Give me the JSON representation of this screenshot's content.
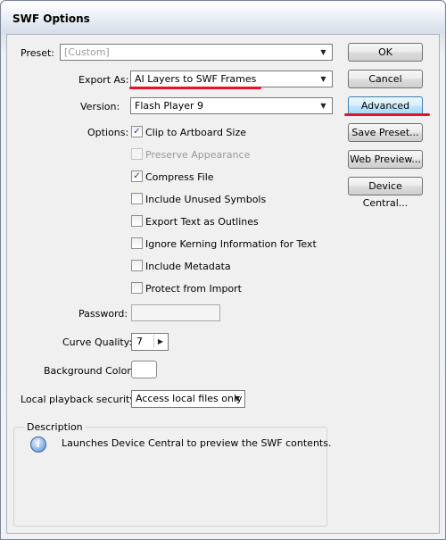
{
  "window": {
    "title": "SWF Options"
  },
  "preset": {
    "label": "Preset:",
    "value": "[Custom]"
  },
  "export_as": {
    "label": "Export As:",
    "value": "AI Layers to SWF Frames"
  },
  "version": {
    "label": "Version:",
    "value": "Flash Player 9"
  },
  "options": {
    "label": "Options:",
    "items": [
      {
        "label": "Clip to Artboard Size",
        "checked": true,
        "enabled": true
      },
      {
        "label": "Preserve Appearance",
        "checked": false,
        "enabled": false
      },
      {
        "label": "Compress File",
        "checked": true,
        "enabled": true
      },
      {
        "label": "Include Unused Symbols",
        "checked": false,
        "enabled": true
      },
      {
        "label": "Export Text as Outlines",
        "checked": false,
        "enabled": true
      },
      {
        "label": "Ignore Kerning Information for Text",
        "checked": false,
        "enabled": true
      },
      {
        "label": "Include Metadata",
        "checked": false,
        "enabled": true
      },
      {
        "label": "Protect from Import",
        "checked": false,
        "enabled": true
      }
    ]
  },
  "password": {
    "label": "Password:",
    "value": ""
  },
  "curve_quality": {
    "label": "Curve Quality:",
    "value": "7"
  },
  "background_color": {
    "label": "Background Color:",
    "color": "#ffffff"
  },
  "local_playback": {
    "label": "Local playback security:",
    "value": "Access local files only"
  },
  "description": {
    "legend": "Description",
    "text": "Launches Device Central to preview the SWF contents."
  },
  "buttons": {
    "ok": "OK",
    "cancel": "Cancel",
    "advanced": "Advanced",
    "save_preset": "Save Preset...",
    "web_preview": "Web Preview...",
    "device_central": "Device Central..."
  },
  "annotations": {
    "highlight_color": "#e8112a"
  },
  "icons": {
    "dropdown": "chevron-down-icon",
    "stepper": "chevron-right-icon",
    "info": "info-icon"
  }
}
